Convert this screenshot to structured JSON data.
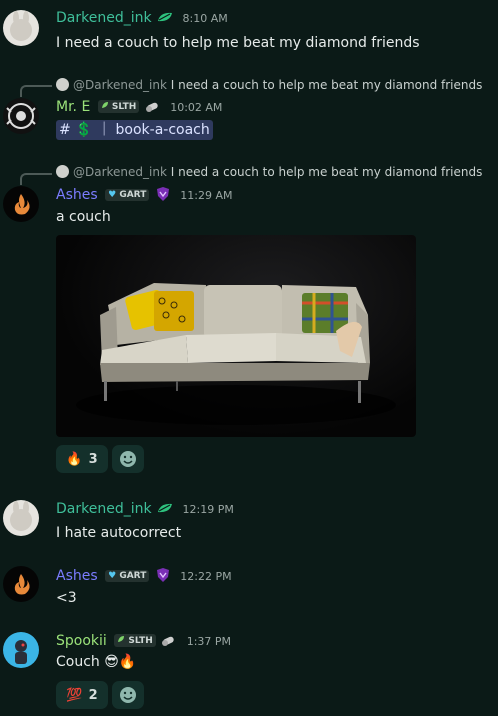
{
  "messages": [
    {
      "author": "Darkened_ink",
      "time": "8:10 AM",
      "text": "I need a couch to help me beat my diamond friends"
    },
    {
      "author": "Mr. E",
      "badge": "SLTH",
      "time": "10:02 AM",
      "reply_mention": "@Darkened_ink",
      "reply_text": "I need a couch to help me beat my diamond friends",
      "channel": "# 💲 ｜ book-a-coach"
    },
    {
      "author": "Ashes",
      "badge": "GART",
      "time": "11:29 AM",
      "reply_mention": "@Darkened_ink",
      "reply_text": "I need a couch to help me beat my diamond friends",
      "text": "a couch",
      "reactions": [
        {
          "emoji": "🔥",
          "count": "3"
        }
      ]
    },
    {
      "author": "Darkened_ink",
      "time": "12:19 PM",
      "text": "I hate autocorrect"
    },
    {
      "author": "Ashes",
      "badge": "GART",
      "time": "12:22 PM",
      "text": "<3"
    },
    {
      "author": "Spookii",
      "badge": "SLTH",
      "time": "1:37 PM",
      "text": "Couch 😎🔥",
      "reactions": [
        {
          "emoji": "💯",
          "count": "2"
        }
      ]
    }
  ],
  "colors": {
    "bg": "#0b1a17",
    "darkened": "#3fbf9a",
    "mre": "#9be27a",
    "ashes": "#7b7cff",
    "spookii": "#9be27a"
  },
  "icons": [
    "leaf-icon",
    "whistle-icon",
    "shield-heart-icon",
    "add-reaction-icon"
  ]
}
